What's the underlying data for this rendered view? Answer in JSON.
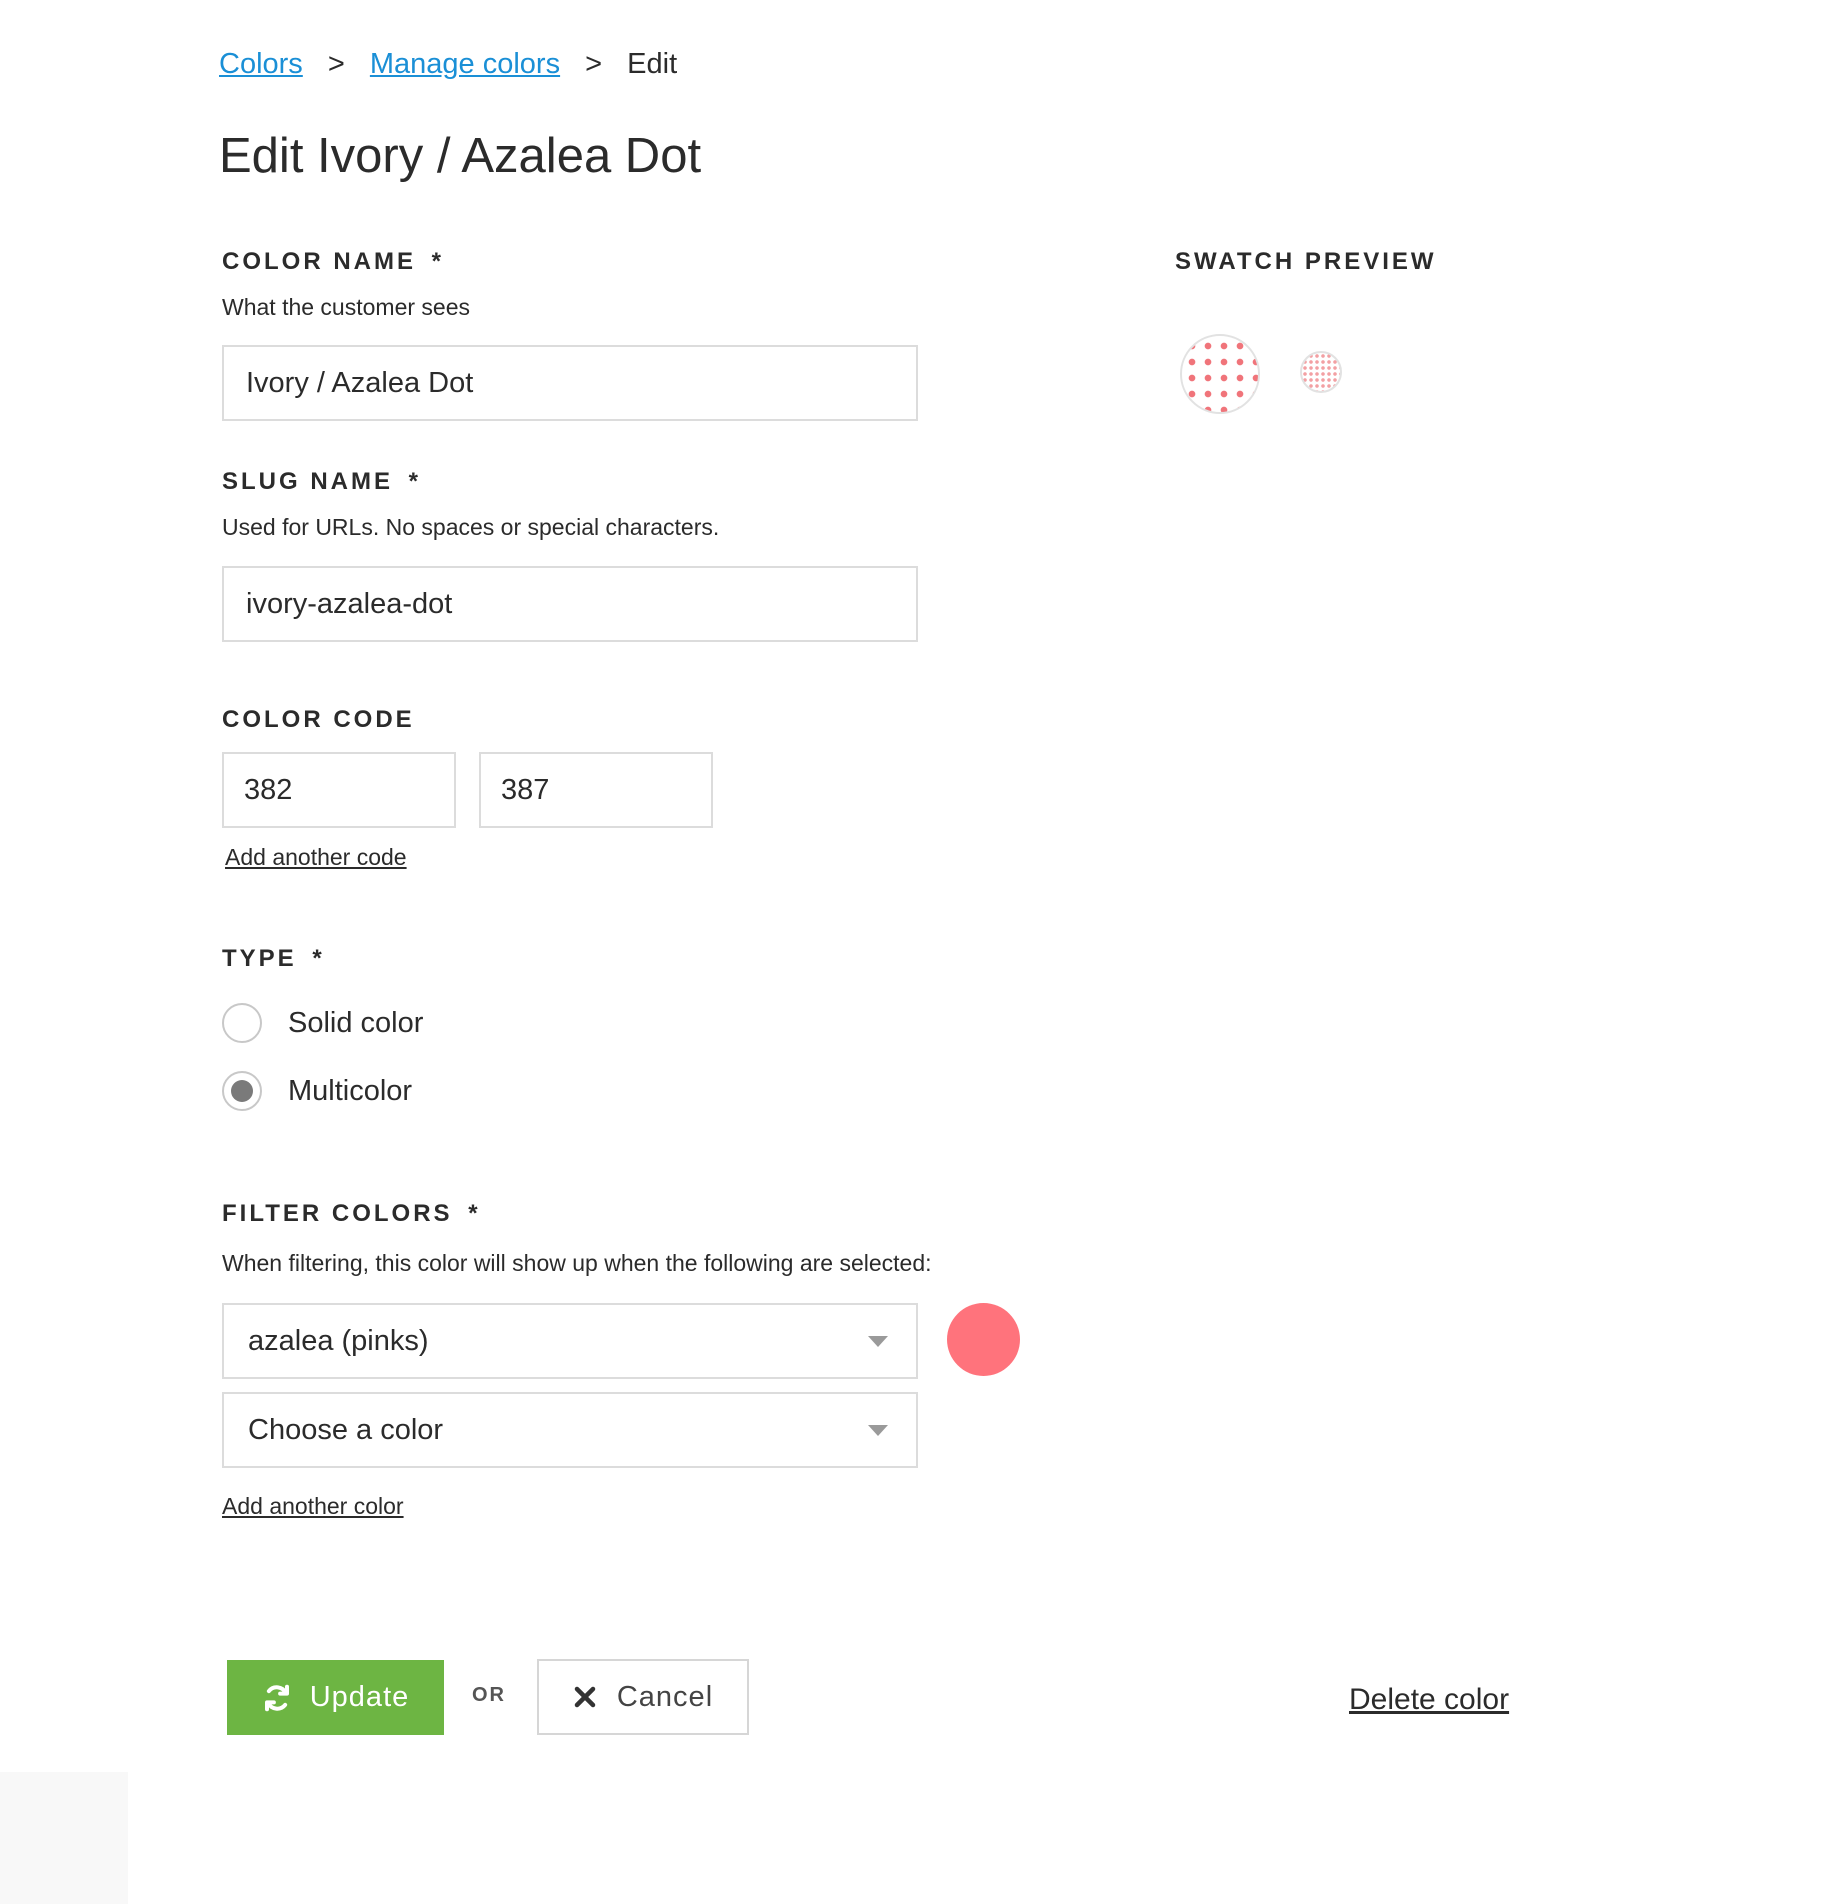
{
  "breadcrumb": {
    "items": [
      "Colors",
      "Manage colors"
    ],
    "separator": ">",
    "current": "Edit"
  },
  "page_title": "Edit Ivory / Azalea Dot",
  "color_name": {
    "label": "COLOR NAME",
    "required_mark": "*",
    "help": "What the customer sees",
    "value": "Ivory / Azalea Dot"
  },
  "slug_name": {
    "label": "SLUG NAME",
    "required_mark": "*",
    "help": "Used for URLs. No spaces or special characters.",
    "value": "ivory-azalea-dot"
  },
  "color_code": {
    "label": "COLOR CODE",
    "codes": [
      "382",
      "387"
    ],
    "add_link": "Add another code"
  },
  "type": {
    "label": "TYPE",
    "required_mark": "*",
    "options": [
      {
        "label": "Solid color",
        "selected": false
      },
      {
        "label": "Multicolor",
        "selected": true
      }
    ]
  },
  "filter_colors": {
    "label": "FILTER COLORS",
    "required_mark": "*",
    "help": "When filtering, this color will show up when the following are selected:",
    "selects": [
      "azalea (pinks)",
      "Choose a color"
    ],
    "selected_swatch_color": "#ff737c",
    "add_link": "Add another color"
  },
  "swatch_preview": {
    "label": "SWATCH PREVIEW",
    "background_color": "#ffffff",
    "dot_color": "#f0747a"
  },
  "actions": {
    "update_label": "Update",
    "or_label": "OR",
    "cancel_label": "Cancel",
    "delete_label": "Delete color",
    "update_color": "#6db543"
  }
}
